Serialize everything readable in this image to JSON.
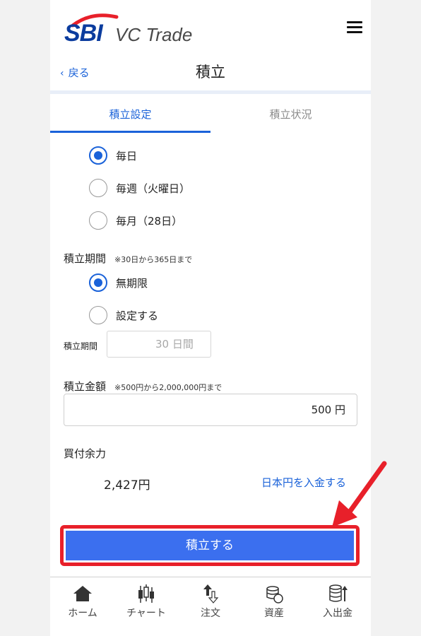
{
  "header": {
    "logo_text": "SBI",
    "logo_subtext": "VC Trade",
    "menu_icon": "hamburger-menu-icon"
  },
  "nav": {
    "back_label": "戻る",
    "title": "積立"
  },
  "tabs": [
    {
      "label": "積立設定",
      "active": true
    },
    {
      "label": "積立状況",
      "active": false
    }
  ],
  "frequency": {
    "options": [
      {
        "label": "毎日",
        "selected": true
      },
      {
        "label": "毎週（火曜日）",
        "selected": false
      },
      {
        "label": "毎月（28日）",
        "selected": false
      }
    ]
  },
  "period": {
    "label": "積立期間",
    "note": "※30日から365日まで",
    "options": [
      {
        "label": "無期限",
        "selected": true
      },
      {
        "label": "設定する",
        "selected": false
      }
    ],
    "input_label": "積立期間",
    "input_value": "30 日間"
  },
  "amount": {
    "label": "積立金額",
    "note": "※500円から2,000,000円まで",
    "value": "500 円"
  },
  "balance": {
    "label": "買付余力",
    "value": "2,427円",
    "deposit_link": "日本円を入金する"
  },
  "submit_label": "積立する",
  "bottom_nav": [
    {
      "label": "ホーム",
      "icon": "home-icon"
    },
    {
      "label": "チャート",
      "icon": "chart-icon"
    },
    {
      "label": "注文",
      "icon": "order-icon"
    },
    {
      "label": "資産",
      "icon": "assets-icon"
    },
    {
      "label": "入出金",
      "icon": "deposit-withdraw-icon"
    }
  ],
  "colors": {
    "accent": "#1a62d9",
    "button": "#3b6fef",
    "highlight": "#e8202a"
  }
}
